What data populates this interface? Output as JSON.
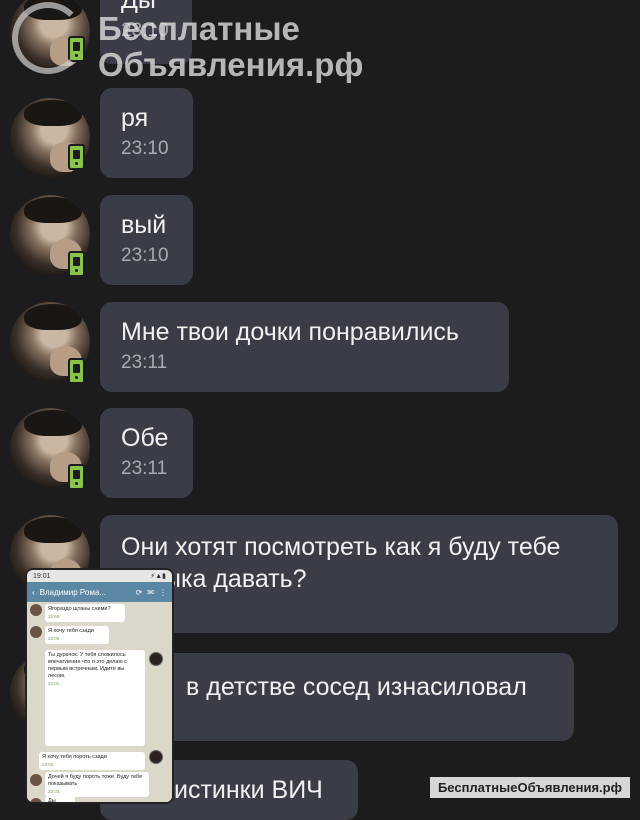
{
  "messages": [
    {
      "text": "Ды",
      "time": "23:10"
    },
    {
      "text": "ря",
      "time": "23:10"
    },
    {
      "text": "вый",
      "time": "23:10"
    },
    {
      "text": "Мне твои дочки понравились",
      "time": "23:11"
    },
    {
      "text": "Обе",
      "time": "23:11"
    },
    {
      "text": "Они хотят посмотреть как я буду тебе\nпалыка давать?",
      "time": ""
    },
    {
      "text": "в детстве сосед изнасиловал",
      "time": ""
    },
    {
      "text": "истинки ВИЧ",
      "time": ""
    }
  ],
  "watermark": {
    "line1": "Бесплатные",
    "line2": "Объявления.рф",
    "bottom": "БесплатныеОбъявления.рф"
  },
  "inset": {
    "status_time": "19:01",
    "status_right": "⚡▲▮",
    "contact_name": "Владимир Рома...",
    "messages": [
      {
        "text": "Ягораздо щтаны сними?",
        "time": "22:59"
      },
      {
        "text": "Я хочу тебя сзади",
        "time": "23:00"
      },
      {
        "text": "Ты дурачок. У тебя сложилось впечатление что я это делаю с первым встречным. Идите вы лесом.",
        "time": "23:01"
      },
      {
        "text": "Я хочу тебя пороть сзади",
        "time": "23:02"
      },
      {
        "text": "Дочей я буду пороть тоже. Буду тебе показывать",
        "time": "23:03"
      },
      {
        "text": "Ды",
        "time": ""
      }
    ]
  },
  "colors": {
    "background": "#1c1c1e",
    "bubble": "#3a3d47",
    "badge": "#8bc34a"
  }
}
